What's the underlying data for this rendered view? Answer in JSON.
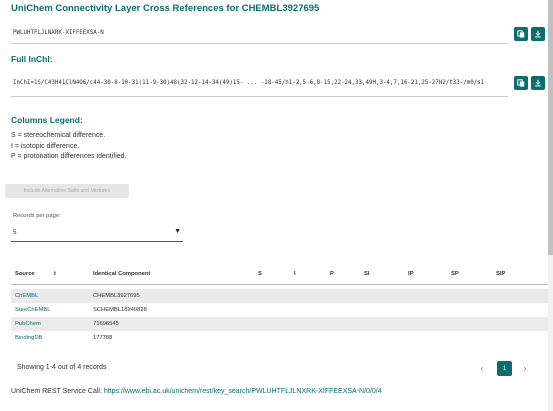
{
  "header": {
    "title": "UniChem Connectivity Layer Cross References for CHEMBL3927695"
  },
  "key": {
    "value": "PWLUHTFLJLNXRK-XIFFEEXSA-N"
  },
  "inchi": {
    "heading": "Full InChI:",
    "value": "InChI=1S/C43H41ClN4O6/c44-30-8-10-31(11-9-30)48(32-12-14-34(49)15- ... -18-45/h1-2,5-6,8-15,22-24,33,49H,3-4,7,16-21,25-27H2/t33-/m0/s1"
  },
  "legend": {
    "heading": "Columns Legend:",
    "lines": [
      "S = stereochemical difference.",
      "I = isotopic difference.",
      "P = protonation differences identified."
    ]
  },
  "controls": {
    "include_alt_label": "Include Alternative Salts and Mixtures",
    "records_per_page_label": "Records per page:",
    "records_per_page_value": "5",
    "records_arrow": "▼"
  },
  "table": {
    "columns": [
      "Source",
      "Identical Component",
      "S",
      "I",
      "P",
      "SI",
      "IP",
      "SP",
      "SIP"
    ],
    "sort_icon": "⇕",
    "rows": [
      {
        "source": "ChEMBL",
        "component": "CHEMBL3927695"
      },
      {
        "source": "SureChEMBL",
        "component": "SCHEMBL18240828"
      },
      {
        "source": "PubChem",
        "component": "71696545"
      },
      {
        "source": "BindingDB",
        "component": "177788"
      }
    ]
  },
  "footer": {
    "count_text": "Showing 1-4 out of 4 records",
    "prev": "‹",
    "current_page": "1",
    "next": "›",
    "rest_label": "UniChem REST Service Call:",
    "rest_url": "https://www.ebi.ac.uk/unichem/rest/key_search/PWLUHTFLJLNXRK-XIFFEEXSA-N/0/0/4"
  },
  "icons": {
    "copy": "copy-icon",
    "download": "download-icon"
  },
  "colors": {
    "accent": "#0b6d6f",
    "row_alt": "#ebebeb"
  }
}
